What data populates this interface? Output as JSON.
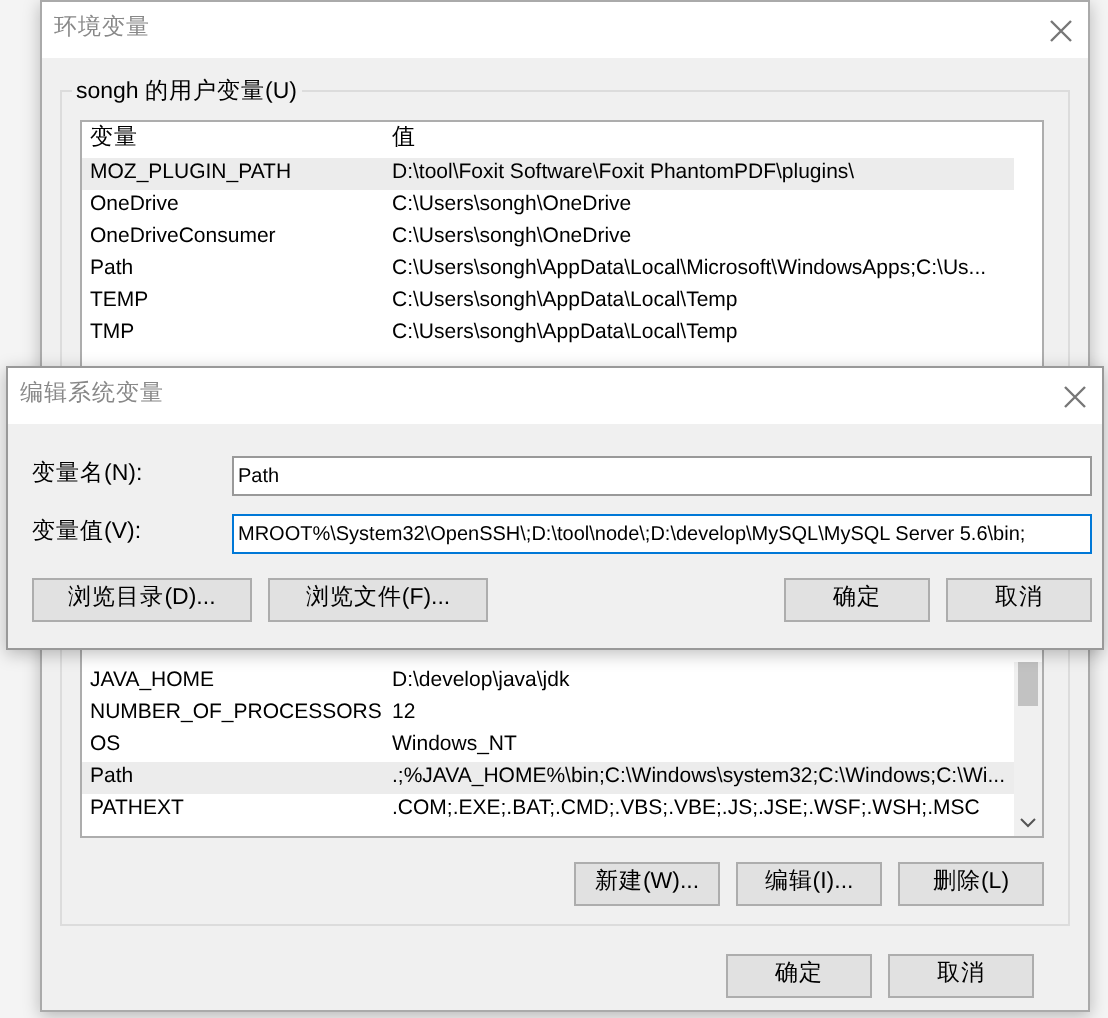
{
  "env_window": {
    "title": "环境变量",
    "user_vars": {
      "label": "songh 的用户变量(U)",
      "columns": [
        "变量",
        "值"
      ],
      "rows": [
        {
          "name": "MOZ_PLUGIN_PATH",
          "value": "D:\\tool\\Foxit Software\\Foxit PhantomPDF\\plugins\\",
          "highlighted": true
        },
        {
          "name": "OneDrive",
          "value": "C:\\Users\\songh\\OneDrive",
          "highlighted": false
        },
        {
          "name": "OneDriveConsumer",
          "value": "C:\\Users\\songh\\OneDrive",
          "highlighted": false
        },
        {
          "name": "Path",
          "value": "C:\\Users\\songh\\AppData\\Local\\Microsoft\\WindowsApps;C:\\Us...",
          "highlighted": false
        },
        {
          "name": "TEMP",
          "value": "C:\\Users\\songh\\AppData\\Local\\Temp",
          "highlighted": false
        },
        {
          "name": "TMP",
          "value": "C:\\Users\\songh\\AppData\\Local\\Temp",
          "highlighted": false
        }
      ]
    },
    "system_vars": {
      "rows": [
        {
          "name": "JAVA_HOME",
          "value": "D:\\develop\\java\\jdk",
          "highlighted": false
        },
        {
          "name": "NUMBER_OF_PROCESSORS",
          "value": "12",
          "highlighted": false
        },
        {
          "name": "OS",
          "value": "Windows_NT",
          "highlighted": false
        },
        {
          "name": "Path",
          "value": ".;%JAVA_HOME%\\bin;C:\\Windows\\system32;C:\\Windows;C:\\Wi...",
          "highlighted": true
        },
        {
          "name": "PATHEXT",
          "value": ".COM;.EXE;.BAT;.CMD;.VBS;.VBE;.JS;.JSE;.WSF;.WSH;.MSC",
          "highlighted": false
        }
      ],
      "buttons": [
        "新建(W)...",
        "编辑(I)...",
        "删除(L)"
      ]
    },
    "buttons": [
      "确定",
      "取消"
    ]
  },
  "edit_dialog": {
    "title": "编辑系统变量",
    "fields": [
      {
        "label": "变量名(N):",
        "value": "Path"
      },
      {
        "label": "变量值(V):",
        "value": "MROOT%\\System32\\OpenSSH\\;D:\\tool\\node\\;D:\\develop\\MySQL\\MySQL Server 5.6\\bin;"
      }
    ],
    "browse_buttons": [
      "浏览目录(D)...",
      "浏览文件(F)..."
    ],
    "buttons": [
      "确定",
      "取消"
    ]
  }
}
